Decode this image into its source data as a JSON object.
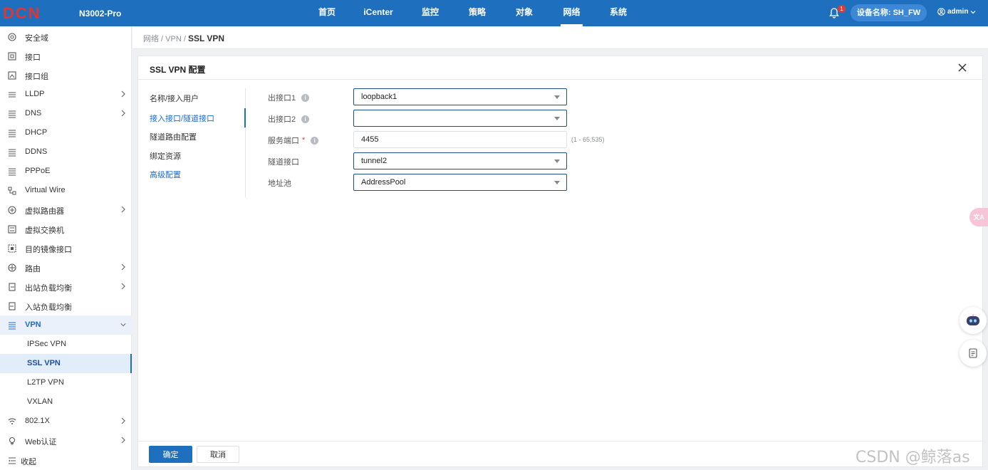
{
  "header": {
    "brand": "DCN",
    "model": "N3002-Pro",
    "nav": [
      "首页",
      "iCenter",
      "监控",
      "策略",
      "对象",
      "网络",
      "系统"
    ],
    "active_nav": "网络",
    "notification_count": "1",
    "device_label": "设备名称: SH_FW",
    "user": "admin",
    "brand_color": "#1f6fbf"
  },
  "sidebar": {
    "items": [
      {
        "label": "安全域",
        "icon": "security-zone-icon"
      },
      {
        "label": "接口",
        "icon": "interface-icon"
      },
      {
        "label": "接口组",
        "icon": "interface-group-icon"
      },
      {
        "label": "LLDP",
        "icon": "lldp-icon"
      },
      {
        "label": "DNS",
        "icon": "dns-icon"
      },
      {
        "label": "DHCP",
        "icon": "dhcp-icon"
      },
      {
        "label": "DDNS",
        "icon": "ddns-icon"
      },
      {
        "label": "PPPoE",
        "icon": "pppoe-icon"
      },
      {
        "label": "Virtual Wire",
        "icon": "virtual-wire-icon"
      },
      {
        "label": "虚拟路由器",
        "icon": "virtual-router-icon"
      },
      {
        "label": "虚拟交换机",
        "icon": "virtual-switch-icon"
      },
      {
        "label": "目的镜像接口",
        "icon": "mirror-interface-icon"
      },
      {
        "label": "路由",
        "icon": "routing-icon"
      },
      {
        "label": "出站负载均衡",
        "icon": "outbound-lb-icon"
      },
      {
        "label": "入站负载均衡",
        "icon": "inbound-lb-icon"
      },
      {
        "label": "VPN",
        "icon": "vpn-icon"
      },
      {
        "label": "IPSec VPN"
      },
      {
        "label": "SSL VPN"
      },
      {
        "label": "L2TP VPN"
      },
      {
        "label": "VXLAN"
      },
      {
        "label": "802.1X",
        "icon": "wireless-8021x-icon"
      },
      {
        "label": "Web认证",
        "icon": "web-auth-icon"
      }
    ],
    "collapse_label": "收起"
  },
  "breadcrumb": {
    "path": "网络 / VPN / ",
    "current": "SSL VPN"
  },
  "dialog": {
    "title": "SSL VPN 配置",
    "tabs": [
      "名称/接入用户",
      "接入接口/隧道接口",
      "隧道路由配置",
      "绑定资源",
      "高级配置"
    ],
    "active_tab": "接入接口/隧道接口",
    "fields": {
      "egress1": {
        "label": "出接口1",
        "value": "loopback1"
      },
      "egress2": {
        "label": "出接口2",
        "value": ""
      },
      "service_port": {
        "label": "服务端口",
        "value": "4455",
        "range_hint": "(1 - 65,535)"
      },
      "tunnel_interface": {
        "label": "隧道接口",
        "value": "tunnel2"
      },
      "address_pool": {
        "label": "地址池",
        "value": "AddressPool"
      }
    },
    "ok_label": "确定",
    "cancel_label": "取消"
  },
  "floating": {
    "translate_badge": "文A"
  },
  "watermark": "CSDN @鲸落as"
}
